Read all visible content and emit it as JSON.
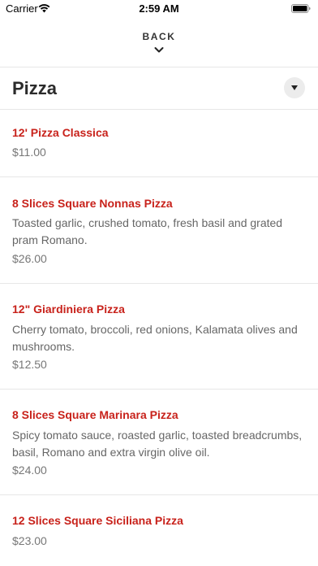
{
  "status_bar": {
    "carrier": "Carrier",
    "time": "2:59 AM",
    "icons": [
      "wifi-icon",
      "battery-icon"
    ]
  },
  "nav": {
    "back_label": "BACK",
    "back_icon": "chevron-down-icon"
  },
  "section": {
    "title": "Pizza",
    "dropdown_icon": "caret-down-icon"
  },
  "colors": {
    "item_name": "#c8221b",
    "text_secondary": "#666666",
    "divider": "#e7e7e7",
    "dropdown_bg": "#ececec"
  },
  "menu_items": [
    {
      "name": "12' Pizza Classica",
      "description": "",
      "price": "$11.00"
    },
    {
      "name": "8 Slices Square Nonnas Pizza",
      "description": "Toasted garlic, crushed tomato, fresh basil and grated pram Romano.",
      "price": "$26.00"
    },
    {
      "name": "12\" Giardiniera Pizza",
      "description": "Cherry tomato, broccoli, red onions, Kalamata olives and mushrooms.",
      "price": "$12.50"
    },
    {
      "name": "8 Slices Square Marinara Pizza",
      "description": "Spicy tomato sauce, roasted garlic, toasted breadcrumbs, basil, Romano and extra virgin olive oil.",
      "price": "$24.00"
    },
    {
      "name": "12 Slices Square Siciliana Pizza",
      "description": "",
      "price": "$23.00"
    }
  ]
}
